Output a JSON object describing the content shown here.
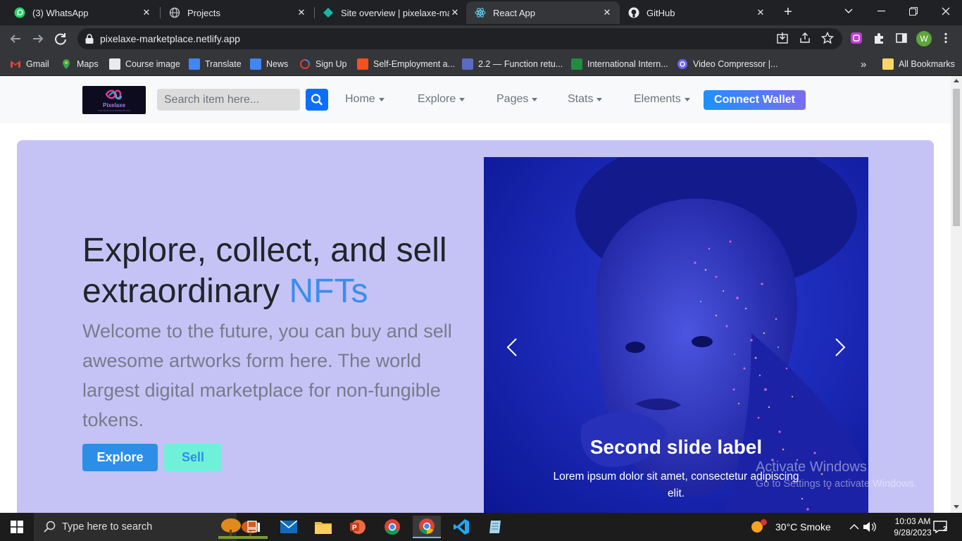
{
  "browser": {
    "tabs": [
      {
        "title": "(3) WhatsApp",
        "icon": "whatsapp-icon",
        "active": false
      },
      {
        "title": "Projects",
        "icon": "globe-icon",
        "active": false
      },
      {
        "title": "Site overview | pixelaxe-marl",
        "icon": "netlify-icon",
        "active": false
      },
      {
        "title": "React App",
        "icon": "react-icon",
        "active": true
      },
      {
        "title": "GitHub",
        "icon": "github-icon",
        "active": false
      }
    ],
    "close_glyph": "✕",
    "new_tab_glyph": "+",
    "url": "pixelaxe-marketplace.netlify.app",
    "profile_initial": "W"
  },
  "bookmarks": [
    {
      "label": "Gmail",
      "color": "#ea4335"
    },
    {
      "label": "Maps",
      "color": "#34a853"
    },
    {
      "label": "Course image",
      "color": "#9aa0a6"
    },
    {
      "label": "Translate",
      "color": "#4285f4"
    },
    {
      "label": "News",
      "color": "#4285f4"
    },
    {
      "label": "Sign Up",
      "color": "#e8eaed"
    },
    {
      "label": "Self-Employment a...",
      "color": "#f4511e"
    },
    {
      "label": "2.2 — Function retu...",
      "color": "#5c6bc0"
    },
    {
      "label": "International Intern...",
      "color": "#1e8e3e"
    },
    {
      "label": "Video Compressor |...",
      "color": "#6c63ff"
    },
    {
      "label": "All Bookmarks",
      "color": "#fdd663"
    }
  ],
  "bookmarks_more": "»",
  "site": {
    "logo_text": "Pixelaxe",
    "logo_tagline": "THE SEAMLESS MARKETPLACE",
    "search_placeholder": "Search item here...",
    "nav": [
      "Home",
      "Explore",
      "Pages",
      "Stats",
      "Elements"
    ],
    "connect_wallet": "Connect Wallet",
    "hero": {
      "title_main": "Explore, collect, and sell extraordinary ",
      "title_accent": "NFTs",
      "subtitle": "Welcome to the future, you can buy and sell awesome artworks form here. The world largest digital marketplace for non-fungible tokens.",
      "explore_btn": "Explore",
      "sell_btn": "Sell"
    },
    "carousel": {
      "caption_title": "Second slide label",
      "caption_text": "Lorem ipsum dolor sit amet, consectetur adipiscing elit."
    }
  },
  "watermark": {
    "line1": "Activate Windows",
    "line2": "Go to Settings to activate Windows."
  },
  "taskbar": {
    "search_placeholder": "Type here to search",
    "weather": "30°C  Smoke",
    "time": "10:03 AM",
    "date": "9/28/2023",
    "notification_count": "2"
  },
  "colors": {
    "accent_blue": "#0d6efd",
    "hero_bg": "#c5c3f6",
    "nft_accent": "#3b8ded"
  }
}
